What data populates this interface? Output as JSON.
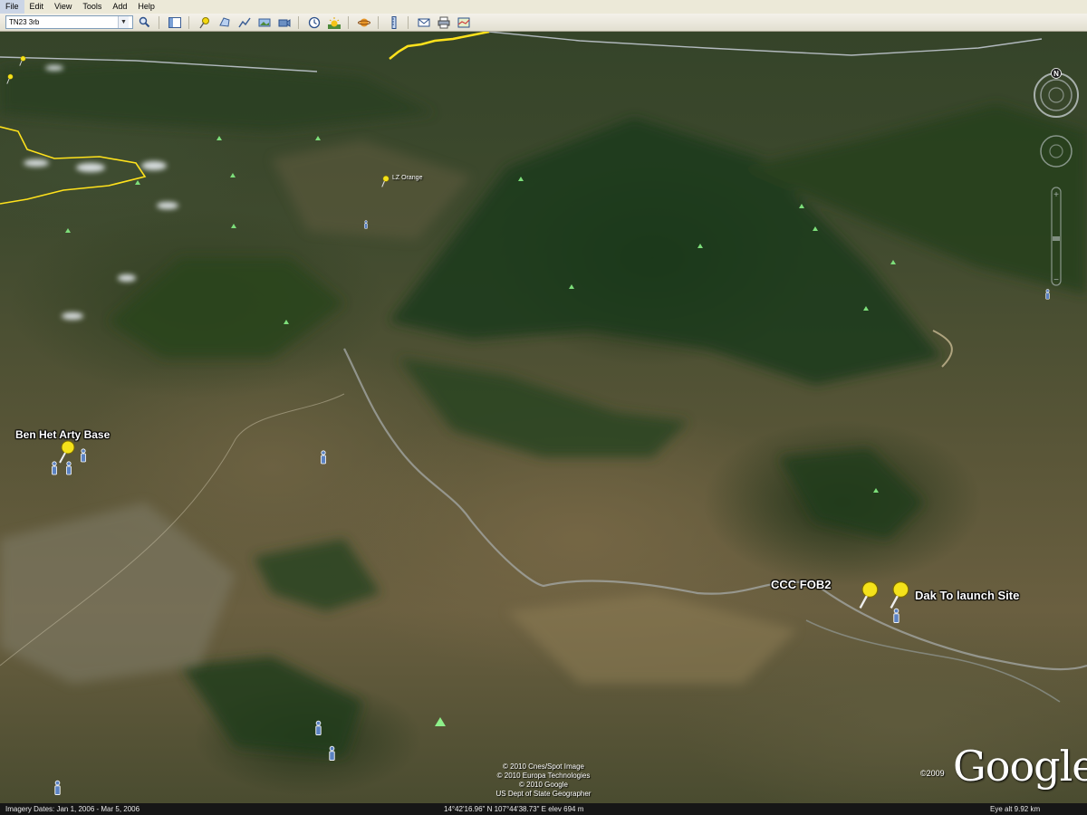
{
  "menu": {
    "items": [
      "File",
      "Edit",
      "View",
      "Tools",
      "Add",
      "Help"
    ]
  },
  "toolbar": {
    "search_value": "TN23 3rb",
    "buttons": [
      "search-button",
      "sidebar-toggle",
      "placemark",
      "polygon",
      "path",
      "image-overlay",
      "record-tour",
      "historical-imagery",
      "sunlight",
      "switch-planets",
      "ruler",
      "email",
      "print",
      "view-in-maps"
    ]
  },
  "map": {
    "labels": {
      "ben_het": "Ben Het Arty Base",
      "lz_orange": "LZ Orange",
      "ccc_fob2": "CCC FOB2",
      "dak_to": "Dak To launch Site"
    },
    "colors": {
      "border_line": "#ffe21c",
      "road_line": "#c8ced8",
      "pin": "#f4e21a",
      "info_icon": "#4a72b0",
      "peak_marker": "#7dde7a"
    }
  },
  "attribution": {
    "lines": [
      "© 2010 Cnes/Spot Image",
      "© 2010 Europa Technologies",
      "© 2010 Google",
      "US Dept of State Geographer"
    ],
    "logo": "Google",
    "logo_year": "©2009"
  },
  "status": {
    "imagery_dates": "Imagery Dates: Jan  1, 2006 - Mar  5, 2006",
    "coords": "14°42'16.96\" N    107°44'38.73\" E    elev  694 m",
    "eye_alt": "Eye alt    9.92 km"
  }
}
